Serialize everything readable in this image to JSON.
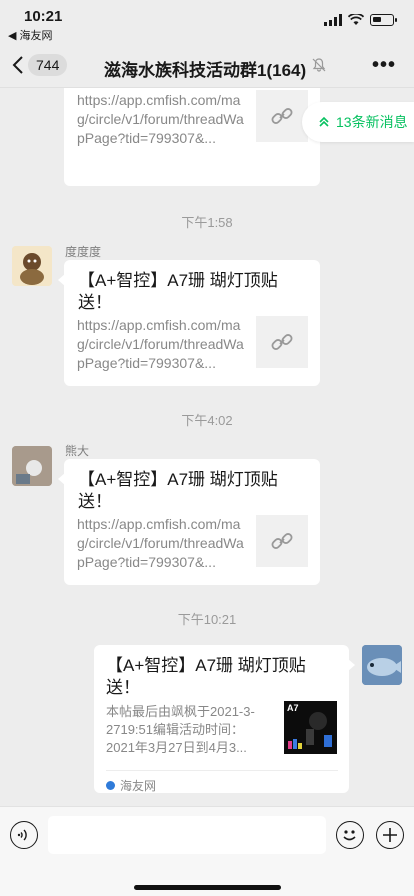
{
  "status_bar": {
    "time": "10:21",
    "back_app": "◀ 海友网"
  },
  "nav": {
    "unread_count": "744",
    "title": "滋海水族科技活动群1(164)"
  },
  "new_messages": {
    "label": "13条新消息"
  },
  "messages": [
    {
      "title": "送！",
      "url": "https://app.cmfish.com/mag/circle/v1/forum/threadWapPage?tid=799307&..."
    },
    {
      "time": "下午1:58",
      "sender": "度度度",
      "title": "【A+智控】A7珊 瑚灯顶贴送！",
      "url": "https://app.cmfish.com/mag/circle/v1/forum/threadWapPage?tid=799307&..."
    },
    {
      "time": "下午4:02",
      "sender": "熊大",
      "title": "【A+智控】A7珊 瑚灯顶贴送！",
      "url": "https://app.cmfish.com/mag/circle/v1/forum/threadWapPage?tid=799307&..."
    },
    {
      "time": "下午10:21",
      "title": "【A+智控】A7珊 瑚灯顶贴送！",
      "desc": "本帖最后由飒枫于2021-3-2719:51编辑活动时间：2021年3月27日到4月3...",
      "thumb_label": "A7",
      "source": "海友网"
    }
  ],
  "colors": {
    "accent": "#07c160",
    "background": "#ededed",
    "bubble": "#ffffff"
  },
  "icons": [
    "chevron-left-icon",
    "mute-bell-icon",
    "more-icon",
    "double-chevron-up-icon",
    "link-icon",
    "voice-icon",
    "emoji-icon",
    "plus-icon"
  ]
}
